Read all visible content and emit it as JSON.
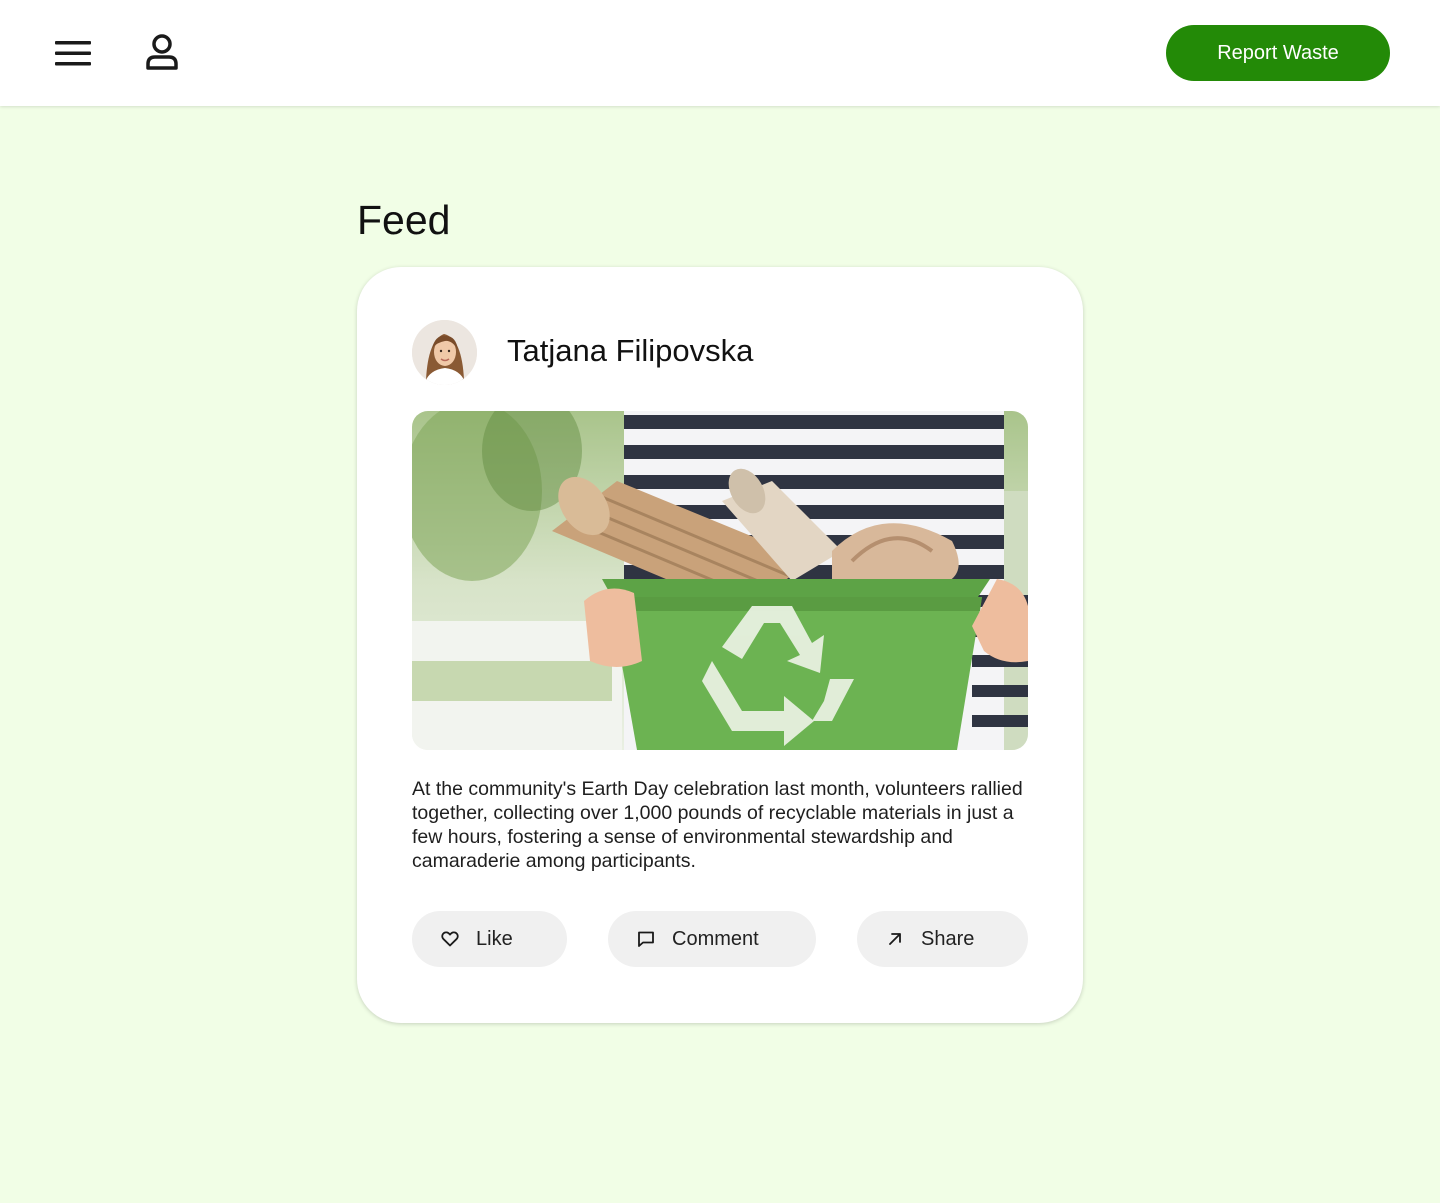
{
  "header": {
    "menu_icon": "hamburger-menu-icon",
    "profile_icon": "user-profile-icon",
    "report_button_label": "Report Waste",
    "accent_color": "#238a07"
  },
  "page": {
    "title": "Feed",
    "background_color": "#f1fee6"
  },
  "post": {
    "author_name": "Tatjana Filipovska",
    "avatar_icon": "user-avatar-photo",
    "image_icon": "recycling-bin-photo",
    "text": "At the community's Earth Day celebration last month, volunteers rallied together, collecting over 1,000 pounds of recyclable materials in just a few hours, fostering a sense of environmental stewardship and camaraderie among participants.",
    "actions": [
      {
        "label": "Like",
        "icon": "heart-icon"
      },
      {
        "label": "Comment",
        "icon": "comment-icon"
      },
      {
        "label": "Share",
        "icon": "share-arrow-icon"
      }
    ]
  }
}
